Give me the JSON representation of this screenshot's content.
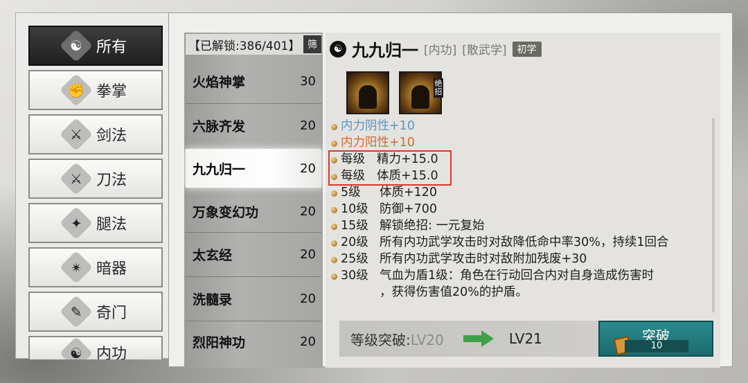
{
  "categories": [
    {
      "label": "所有",
      "icon": "all-icon",
      "glyph": "☯"
    },
    {
      "label": "拳掌",
      "icon": "fist-icon",
      "glyph": "✊"
    },
    {
      "label": "剑法",
      "icon": "sword-icon",
      "glyph": "⚔"
    },
    {
      "label": "刀法",
      "icon": "blade-icon",
      "glyph": "⚔"
    },
    {
      "label": "腿法",
      "icon": "leg-icon",
      "glyph": "✦"
    },
    {
      "label": "暗器",
      "icon": "shuriken-icon",
      "glyph": "✴"
    },
    {
      "label": "奇门",
      "icon": "scroll-icon",
      "glyph": "✎"
    },
    {
      "label": "内功",
      "icon": "inner-icon",
      "glyph": "☯"
    }
  ],
  "list": {
    "header": "【已解锁:386/401】",
    "filter_label": "筛",
    "skills": [
      {
        "name": "火焰神掌",
        "level": "30"
      },
      {
        "name": "六脉齐发",
        "level": "20"
      },
      {
        "name": "九九归一",
        "level": "20"
      },
      {
        "name": "万象变幻功",
        "level": "20"
      },
      {
        "name": "太玄经",
        "level": "20"
      },
      {
        "name": "洗髓录",
        "level": "20"
      },
      {
        "name": "烈阳神功",
        "level": "20"
      }
    ]
  },
  "detail": {
    "title": "九九归一",
    "tag_type": "[内功]",
    "tag_school": "[散武学]",
    "tag_level": "初学",
    "ult_badge": "绝招",
    "effects": [
      {
        "lvl": "",
        "text": "内力阴性+10",
        "style": "blue"
      },
      {
        "lvl": "",
        "text": "内力阳性+10",
        "style": "red"
      },
      {
        "lvl": "每级",
        "text": "精力+15.0",
        "style": ""
      },
      {
        "lvl": "每级",
        "text": "体质+15.0",
        "style": ""
      },
      {
        "lvl": "5级",
        "text": "体质+120",
        "style": ""
      },
      {
        "lvl": "10级",
        "text": "防御+700",
        "style": ""
      },
      {
        "lvl": "15级",
        "text": "解锁绝招:  一元复始",
        "style": ""
      },
      {
        "lvl": "20级",
        "text": "所有内功武学攻击时对敌降低命中率30%，持续1回合",
        "style": ""
      },
      {
        "lvl": "25级",
        "text": "所有内功武学攻击时对敌附加残废+30",
        "style": ""
      },
      {
        "lvl": "30级",
        "text": "气血为盾1级：角色在行动回合内对自身造成伤害时",
        "text2": "，获得伤害值20%的护盾。",
        "style": ""
      }
    ]
  },
  "breakthrough": {
    "label": "等级突破:",
    "current": "LV20",
    "next": "LV21",
    "button_label": "突破",
    "cost": "10"
  }
}
